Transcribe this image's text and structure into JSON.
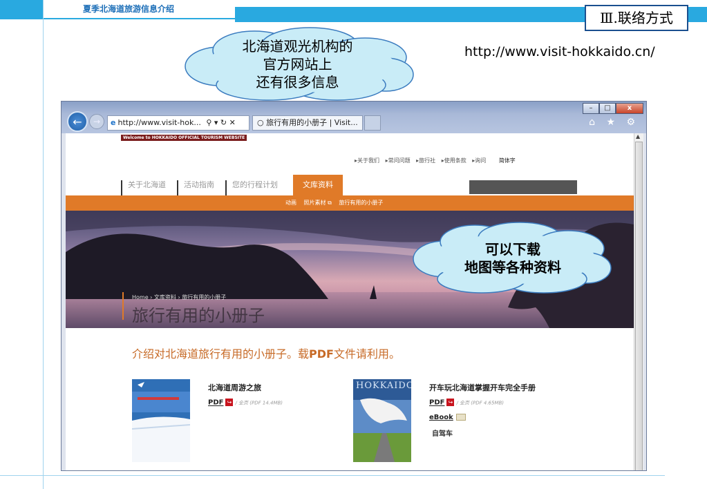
{
  "slide": {
    "header_title": "夏季北海道旅游信息介绍",
    "section_label": "Ⅲ.联络方式",
    "url": "http://www.visit-hokkaido.cn/"
  },
  "callouts": {
    "top": [
      "北海道观光机构的",
      "官方网站上",
      "还有很多信息"
    ],
    "right": [
      "可以下载",
      "地图等各种资料"
    ]
  },
  "browser": {
    "address": "http://www.visit-hok...",
    "tab_label": "旅行有用的小册子 | Visit...",
    "tab_close": "×",
    "window_controls": {
      "minimize": "–",
      "maximize": "□",
      "close": "x"
    },
    "tool_icons": "⌂ ★ ⚙"
  },
  "site": {
    "banner": "Welcome to HOKKAIDO OFFICIAL TOURISM WEBSITE",
    "util_nav": [
      "▸关于我们",
      "▸常问问题",
      "▸旅行社",
      "▸使用条款",
      "▸询问"
    ],
    "simplified_label": "简体字",
    "main_nav": [
      "关于北海道",
      "活动指南",
      "您的行程计划"
    ],
    "main_nav_active": "文库资料",
    "sub_nav": [
      "动画",
      "照片素材 ⧉",
      "旅行有用的小册子"
    ],
    "breadcrumb": "Home › 文库资料 › 旅行有用的小册子",
    "hero_title": "旅行有用的小册子",
    "intro_before": "介绍对北海道旅行有用的小册子。载",
    "intro_pdf": "PDF",
    "intro_after": "文件请利用。"
  },
  "booklets": [
    {
      "title": "北海道周游之旅",
      "pdf_label": "PDF",
      "pdf_note": "/ 全页 (PDF 14.4MB)"
    },
    {
      "title": "开车玩北海道掌握开车完全手册",
      "pdf_label": "PDF",
      "pdf_note": "/ 全页 (PDF 4.65MB)",
      "ebook_label": "eBook",
      "extra_label": "自驾车",
      "cover_text": "HOKKAIDO"
    }
  ]
}
